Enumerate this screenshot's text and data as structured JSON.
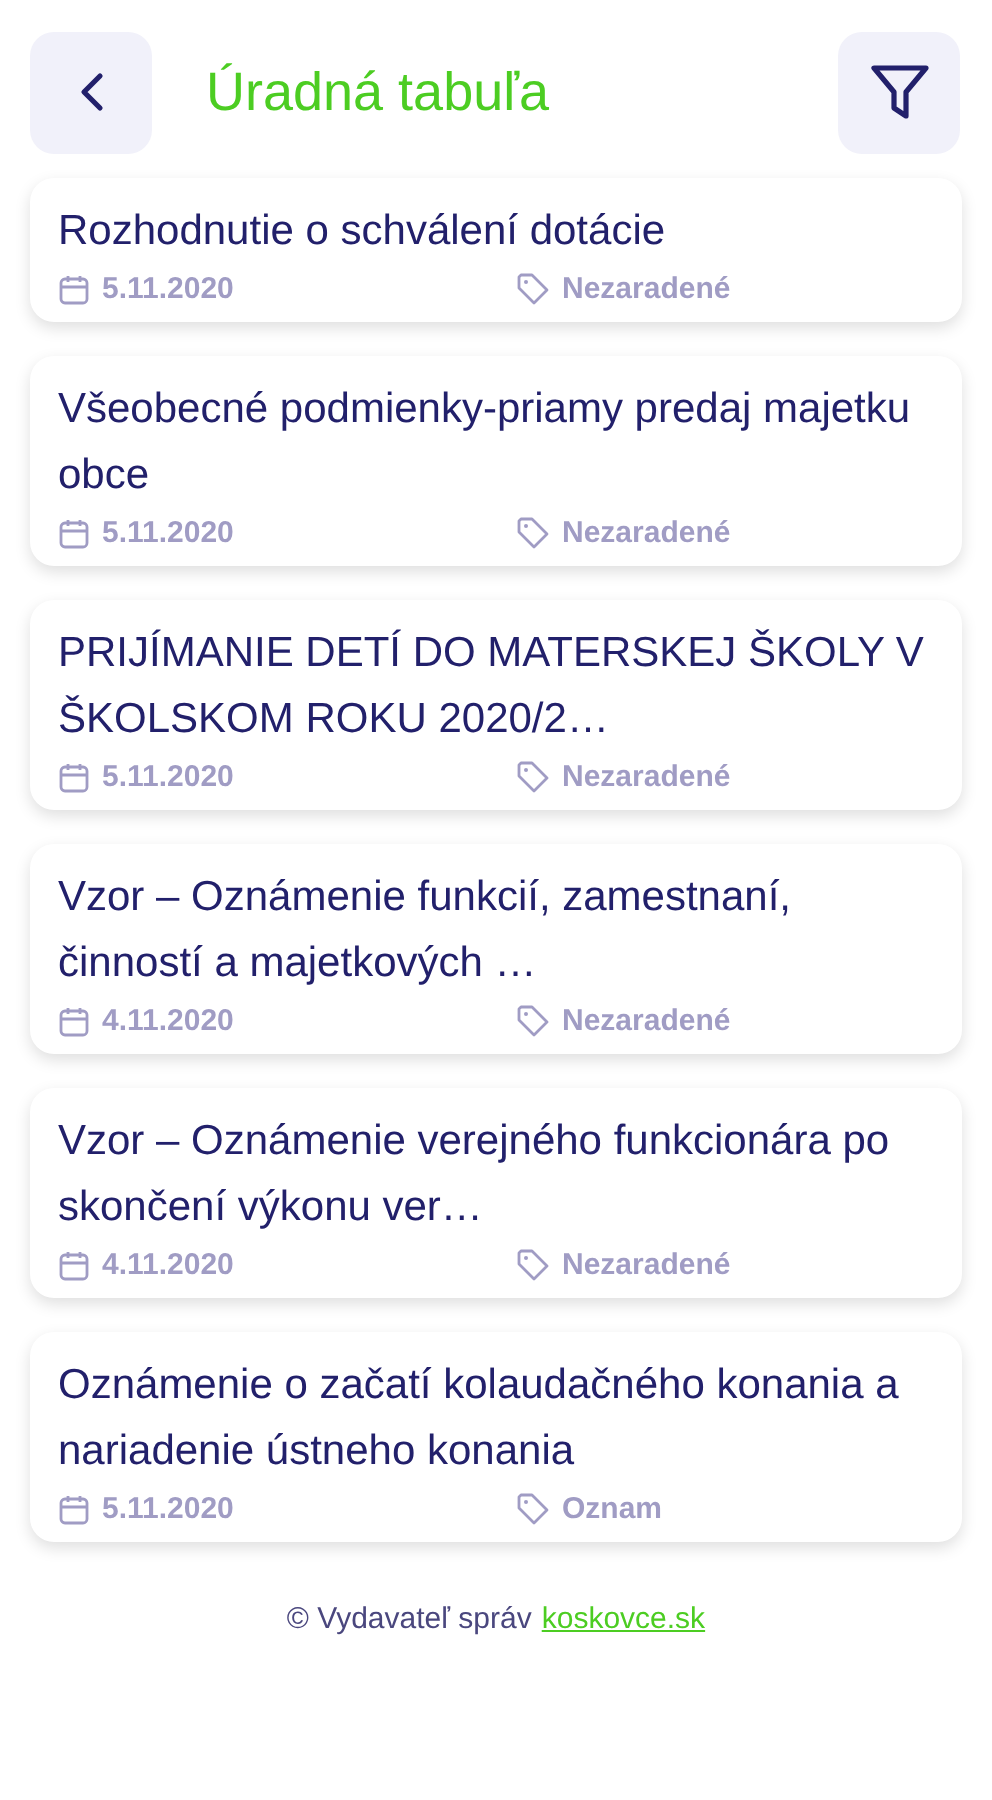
{
  "header": {
    "title": "Úradná tabuľa"
  },
  "notices": [
    {
      "title": "Rozhodnutie o schválení dotácie",
      "date": "5.11.2020",
      "category": "Nezaradené"
    },
    {
      "title": "Všeobecné podmienky-priamy predaj majetku obce",
      "date": "5.11.2020",
      "category": "Nezaradené"
    },
    {
      "title": "PRIJÍMANIE DETÍ DO MATERSKEJ ŠKOLY V ŠKOLSKOM ROKU 2020/2…",
      "date": "5.11.2020",
      "category": "Nezaradené"
    },
    {
      "title": "Vzor – Oznámenie funkcií, zamestnaní, činností a majetkových …",
      "date": "4.11.2020",
      "category": "Nezaradené"
    },
    {
      "title": "Vzor – Oznámenie verejného funkcionára po skončení výkonu ver…",
      "date": "4.11.2020",
      "category": "Nezaradené"
    },
    {
      "title": "Oznámenie o začatí kolaudačného konania a nariadenie ústneho konania",
      "date": "5.11.2020",
      "category": "Oznam"
    }
  ],
  "footer": {
    "text": "© Vydavateľ správ",
    "link": "koskovce.sk"
  }
}
